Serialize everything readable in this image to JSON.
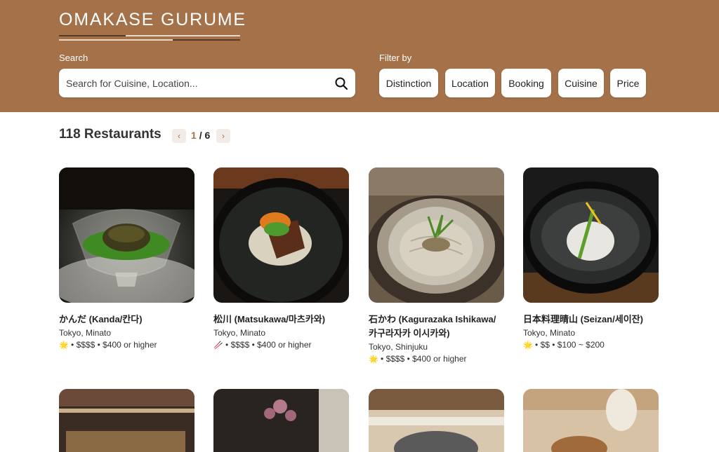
{
  "header": {
    "logo": "OMAKASE GURUME",
    "search_label": "Search",
    "search_placeholder": "Search for Cuisine, Location...",
    "filter_label": "Filter by",
    "filters": [
      "Distinction",
      "Location",
      "Booking",
      "Cuisine",
      "Price"
    ]
  },
  "results": {
    "count_text": "118 Restaurants",
    "current_page": "1",
    "total_pages": "/ 6"
  },
  "cards": [
    {
      "name": "かんだ (Kanda/칸다)",
      "location": "Tokyo, Minato",
      "meta": " • $$$$ • $400 or higher",
      "icon": "star-icon"
    },
    {
      "name": "松川 (Matsukawa/마츠카와)",
      "location": "Tokyo, Minato",
      "meta": " • $$$$ • $400 or higher",
      "icon": "chopsticks-icon"
    },
    {
      "name": "石かわ (Kagurazaka Ishikawa/카구라자카 이시카와)",
      "location": "Tokyo, Shinjuku",
      "meta": " • $$$$ • $400 or higher",
      "icon": "star-icon"
    },
    {
      "name": "日本料理晴山 (Seizan/세이잔)",
      "location": "Tokyo, Minato",
      "meta": " • $$ • $100 ~ $200",
      "icon": "star-icon"
    }
  ],
  "colors": {
    "brand": "#A47149",
    "pager_bg": "#f1ece7"
  }
}
